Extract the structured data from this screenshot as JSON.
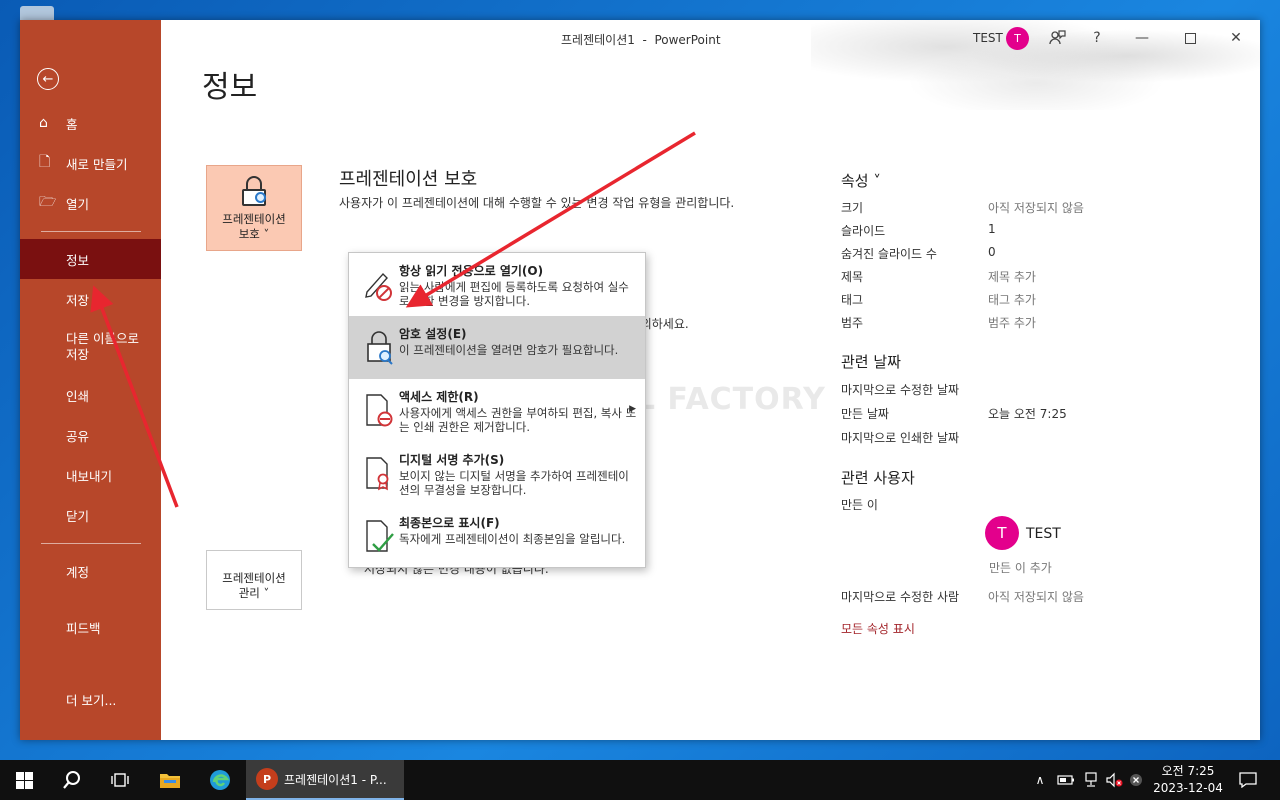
{
  "window": {
    "doc_title": "프레젠테이션1  -  PowerPoint",
    "user_name": "TEST",
    "user_initial": "T"
  },
  "sidebar": {
    "items": [
      {
        "label": "홈",
        "icon": "home-icon"
      },
      {
        "label": "새로 만들기",
        "icon": "new-document-icon"
      },
      {
        "label": "열기",
        "icon": "folder-open-icon"
      },
      {
        "label": "정보"
      },
      {
        "label": "저장"
      },
      {
        "label": "다른 이름으로\n저장"
      },
      {
        "label": "인쇄"
      },
      {
        "label": "공유"
      },
      {
        "label": "내보내기"
      },
      {
        "label": "닫기"
      },
      {
        "label": "계정"
      },
      {
        "label": "피드백"
      },
      {
        "label": "더 보기..."
      }
    ]
  },
  "main": {
    "page_title": "정보",
    "protect": {
      "button_label": "프레젠테이션\n보호 ˅",
      "title": "프레젠테이션 보호",
      "description": "사용자가 이 프레젠테이션에 대해 수행할 수 있는 변경 작업 유형을 관리합니다."
    },
    "inspect_partial": "이 포함되어 있다는 점에 주의하세요.",
    "manage": {
      "button_label": "프레젠테이션\n관리 ˅",
      "partial": "저장되지 않은 변경 내용이 없습니다."
    },
    "watermark": "MANUAL FACTORY"
  },
  "dropdown": {
    "items": [
      {
        "title": "항상 읽기 전용으로 열기(O)",
        "desc": "읽는 사람에게 편집에 등록하도록 요청하여 실수로 인한 변경을 방지합니다.",
        "icon": "pencil-no-icon"
      },
      {
        "title": "암호 설정(E)",
        "desc": "이 프레젠테이션을 열려면 암호가 필요합니다.",
        "icon": "lock-key-icon"
      },
      {
        "title": "액세스 제한(R)",
        "desc": "사용자에게 액세스 권한을 부여하되 편집, 복사 또는 인쇄 권한은 제거합니다.",
        "icon": "restricted-doc-icon"
      },
      {
        "title": "디지털 서명 추가(S)",
        "desc": "보이지 않는 디지털 서명을 추가하여 프레젠테이션의 무결성을 보장합니다.",
        "icon": "signature-doc-icon"
      },
      {
        "title": "최종본으로 표시(F)",
        "desc": "독자에게 프레젠테이션이 최종본임을 알립니다.",
        "icon": "final-doc-icon"
      }
    ]
  },
  "properties": {
    "heading": "속성 ˅",
    "rows": [
      {
        "k": "크기",
        "v": "아직 저장되지 않음"
      },
      {
        "k": "슬라이드",
        "v": "1"
      },
      {
        "k": "숨겨진 슬라이드 수",
        "v": "0"
      },
      {
        "k": "제목",
        "v": "제목 추가"
      },
      {
        "k": "태그",
        "v": "태그 추가"
      },
      {
        "k": "범주",
        "v": "범주 추가"
      }
    ],
    "dates_heading": "관련 날짜",
    "dates": [
      {
        "k": "마지막으로 수정한 날짜",
        "v": ""
      },
      {
        "k": "만든 날짜",
        "v": "오늘 오전 7:25"
      },
      {
        "k": "마지막으로 인쇄한 날짜",
        "v": ""
      }
    ],
    "people_heading": "관련 사용자",
    "author_label": "만든 이",
    "author_name": "TEST",
    "author_initial": "T",
    "add_author": "만든 이 추가",
    "last_modified_by_label": "마지막으로 수정한 사람",
    "last_modified_by_value": "아직 저장되지 않음",
    "show_all": "모든 속성 표시"
  },
  "taskbar": {
    "app_label": "프레젠테이션1 - P...",
    "app_badge": "P",
    "time": "오전 7:25",
    "date": "2023-12-04"
  },
  "colors": {
    "sidebar": "#b7472a",
    "sidebar_active": "#7a1010",
    "accent_avatar": "#e3008c",
    "arrow": "#e8262f"
  }
}
